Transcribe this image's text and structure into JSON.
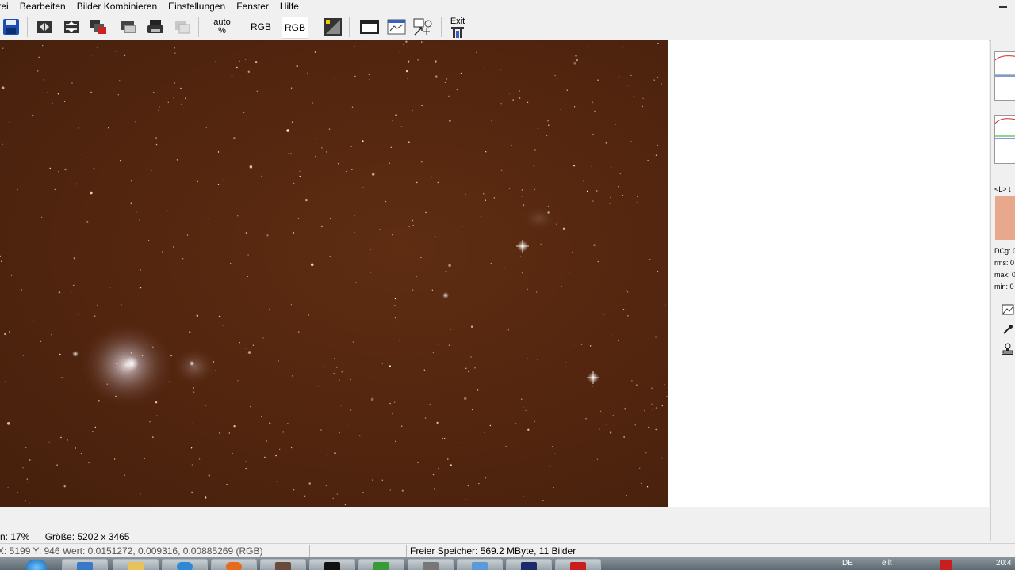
{
  "menubar": {
    "items": [
      "tei",
      "Bearbeiten",
      "Bilder Kombinieren",
      "Einstellungen",
      "Fenster",
      "Hilfe"
    ]
  },
  "toolbar": {
    "auto_label_top": "auto",
    "auto_label_bottom": "%",
    "rgb_label_1": "RGB",
    "rgb_label_2": "RGB",
    "exit_label": "Exit",
    "icons": [
      "save-icon",
      "open-icon",
      "transform-icon",
      "stack-icon",
      "layer-icon",
      "print-icon",
      "compare-icon",
      "histogram-icon",
      "window-icon",
      "graph-icon",
      "crosshair-icon",
      "exit-icon"
    ]
  },
  "image": {
    "description_icon": "star-field-image"
  },
  "right_panel": {
    "label_l": "<L> t",
    "stats": [
      "DCg: 0",
      "rms: 0",
      "max: 0",
      "min: 0"
    ]
  },
  "status": {
    "zoom": "n: 17%",
    "size": "Größe: 5202 x 3465",
    "coords": "X: 5199  Y: 946  Wert: 0.0151272, 0.009316, 0.00885269 (RGB)",
    "memory": "Freier Speicher: 569.2 MByte, 11 Bilder"
  },
  "taskbar": {
    "tray_lang": "DE",
    "tray_misc": "ellt      ",
    "clock": "20:4"
  },
  "colors": {
    "sky": "#54260f",
    "panel": "#f0f0f0",
    "preview": "#e8a88e"
  }
}
